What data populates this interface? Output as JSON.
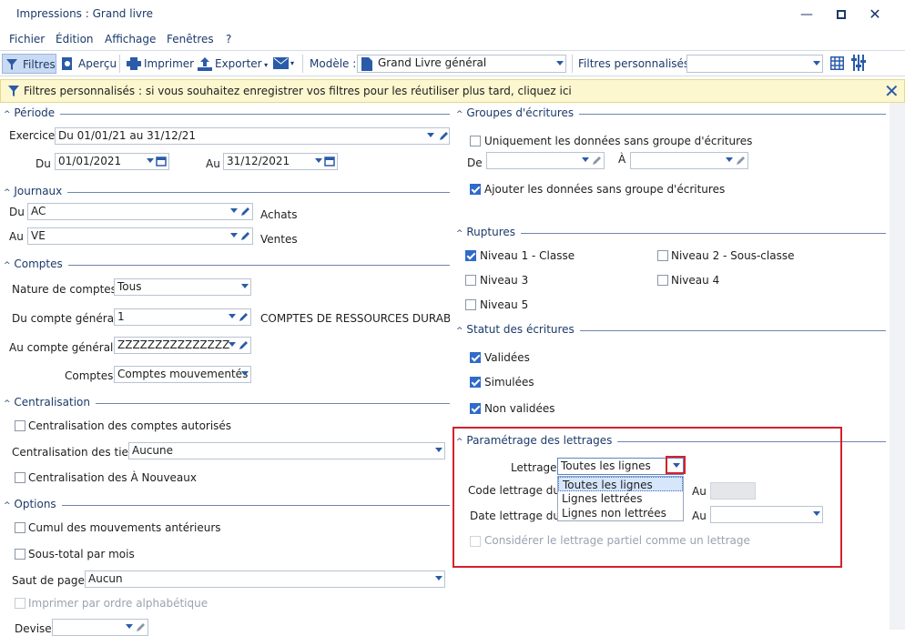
{
  "window": {
    "title": "Impressions : Grand livre"
  },
  "menu": [
    "Fichier",
    "Édition",
    "Affichage",
    "Fenêtres",
    "?"
  ],
  "toolbar": {
    "filtres": "Filtres",
    "apercu": "Aperçu",
    "imprimer": "Imprimer",
    "exporter": "Exporter",
    "modele_label": "Modèle :",
    "modele_value": "Grand Livre général",
    "filtres_perso_label": "Filtres personnalisés :",
    "filtres_perso_value": ""
  },
  "info": {
    "text": "Filtres personnalisés : si vous souhaitez enregistrer vos filtres pour les réutiliser plus tard, cliquez ici"
  },
  "periode": {
    "title": "Période",
    "exercice_label": "Exercice",
    "exercice_value": "Du 01/01/21 au 31/12/21",
    "du_label": "Du",
    "du_value": "01/01/2021",
    "au_label": "Au",
    "au_value": "31/12/2021"
  },
  "journaux": {
    "title": "Journaux",
    "du_label": "Du",
    "du_value": "AC",
    "du_desc": "Achats",
    "au_label": "Au",
    "au_value": "VE",
    "au_desc": "Ventes"
  },
  "comptes": {
    "title": "Comptes",
    "nature_label": "Nature de comptes",
    "nature_value": "Tous",
    "du_label": "Du compte général",
    "du_value": "1",
    "du_desc": "COMPTES DE RESSOURCES DURABLES",
    "au_label": "Au compte général",
    "au_value": "ZZZZZZZZZZZZZZZ",
    "comptes_label": "Comptes",
    "comptes_value": "Comptes mouvementés"
  },
  "centralisation": {
    "title": "Centralisation",
    "autorises": "Centralisation des comptes autorisés",
    "tiers_label": "Centralisation des tiers",
    "tiers_value": "Aucune",
    "a_nouveaux": "Centralisation des À Nouveaux"
  },
  "options": {
    "title": "Options",
    "cumul": "Cumul des mouvements antérieurs",
    "sous_total": "Sous-total par mois",
    "saut_label": "Saut de page",
    "saut_value": "Aucun",
    "alpha": "Imprimer par ordre alphabétique",
    "devise_label": "Devise"
  },
  "groupes": {
    "title": "Groupes d'écritures",
    "uniquement": "Uniquement les données sans groupe d'écritures",
    "de_label": "De",
    "a_label": "À",
    "ajouter": "Ajouter les données sans groupe d'écritures"
  },
  "ruptures": {
    "title": "Ruptures",
    "n1": "Niveau 1 - Classe",
    "n2": "Niveau 2 - Sous-classe",
    "n3": "Niveau 3",
    "n4": "Niveau 4",
    "n5": "Niveau 5"
  },
  "statut": {
    "title": "Statut des écritures",
    "validees": "Validées",
    "simulees": "Simulées",
    "non_validees": "Non validées"
  },
  "lettrage": {
    "title": "Paramétrage des lettrages",
    "lettrage_label": "Lettrage",
    "lettrage_value": "Toutes les lignes",
    "code_label": "Code lettrage du",
    "date_label": "Date lettrage du",
    "au_label": "Au",
    "partiel": "Considérer le lettrage partiel comme un lettrage",
    "options": [
      "Toutes les lignes",
      "Lignes lettrées",
      "Lignes non lettrées"
    ]
  },
  "colors": {
    "accent": "#2f6bc9",
    "highlight": "#d5212c",
    "info_bg": "#fcf7cf"
  }
}
